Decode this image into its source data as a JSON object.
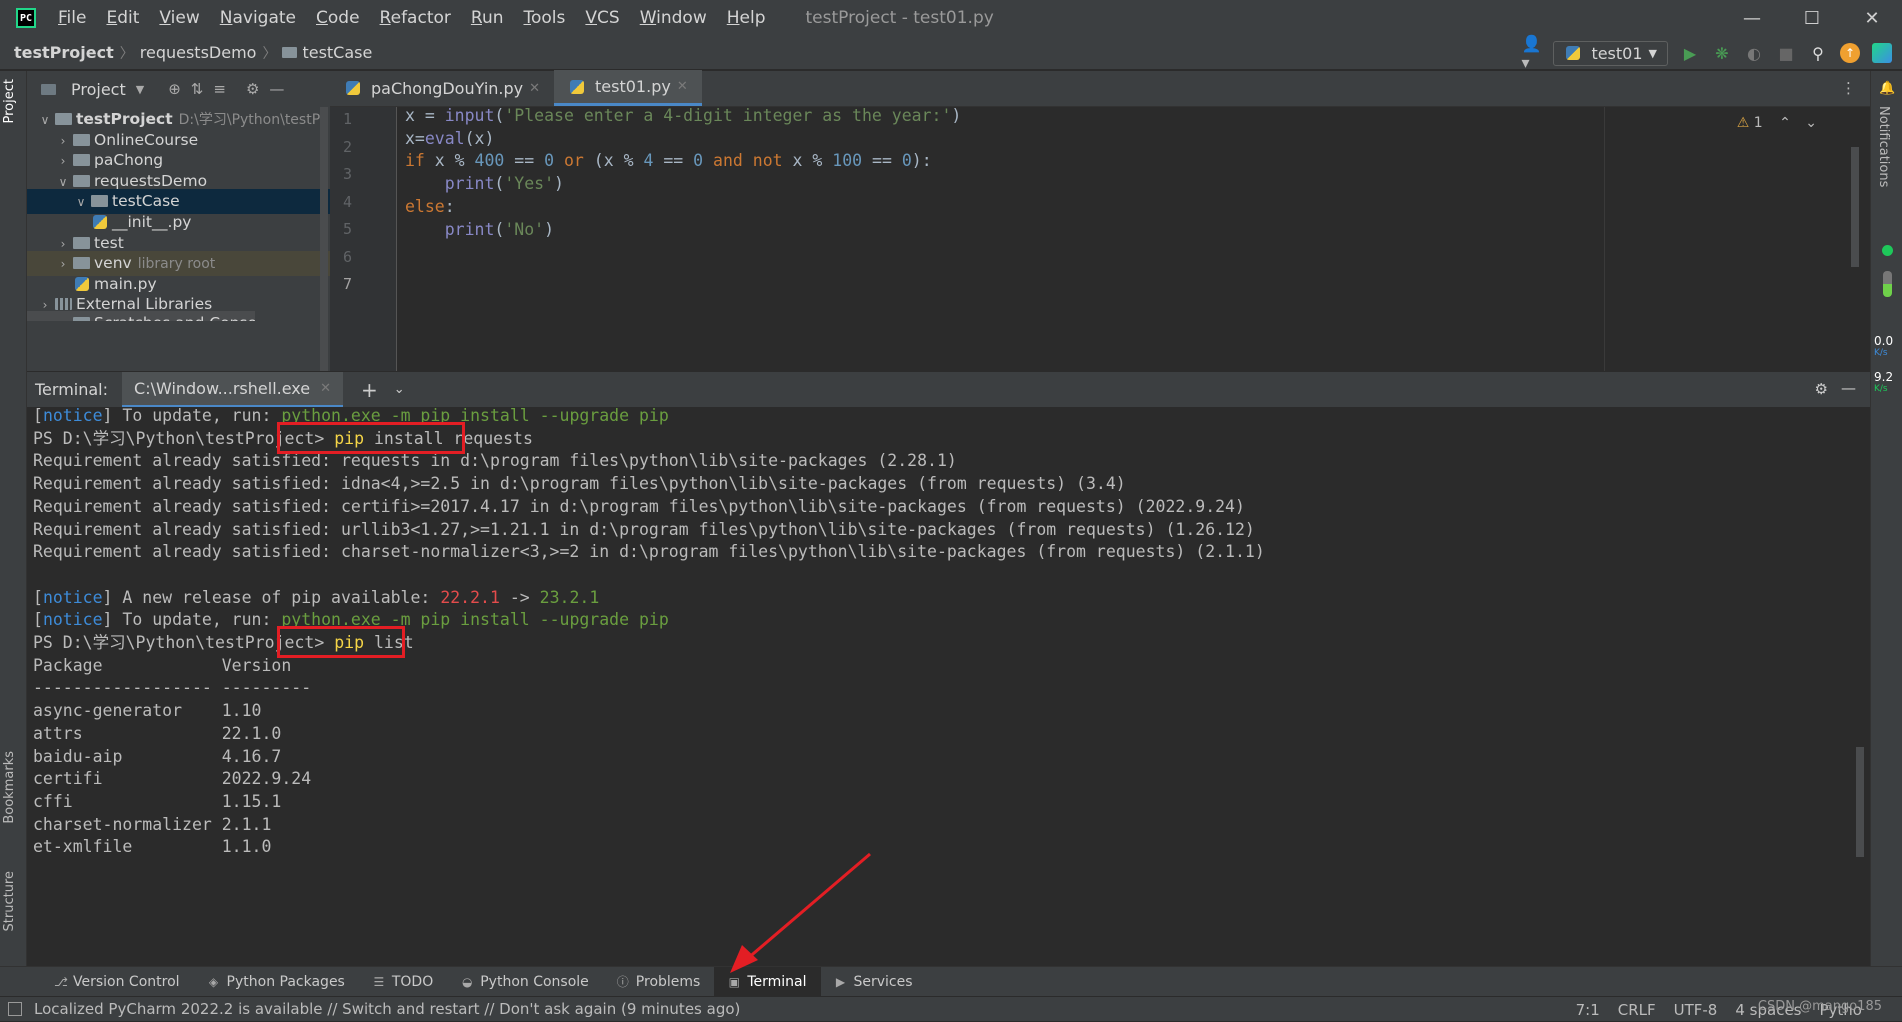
{
  "window": {
    "title": "testProject - test01.py",
    "menu": [
      {
        "u": "F",
        "rest": "ile"
      },
      {
        "u": "E",
        "rest": "dit"
      },
      {
        "u": "V",
        "rest": "iew"
      },
      {
        "u": "N",
        "rest": "avigate"
      },
      {
        "u": "C",
        "rest": "ode"
      },
      {
        "u": "R",
        "rest": "efactor"
      },
      {
        "u": "R",
        "rest": "un"
      },
      {
        "u": "T",
        "rest": "ools"
      },
      {
        "u": "V",
        "rest": "CS"
      },
      {
        "u": "W",
        "rest": "indow"
      },
      {
        "u": "H",
        "rest": "elp"
      }
    ]
  },
  "breadcrumb": [
    "testProject",
    "requestsDemo",
    "testCase"
  ],
  "run_config": "test01",
  "project_panel": {
    "title": "Project",
    "tree": [
      {
        "label": "testProject",
        "extra": "D:\\学习\\Python\\testPr",
        "depth": 0,
        "expanded": true,
        "bold": true
      },
      {
        "label": "OnlineCourse",
        "depth": 1
      },
      {
        "label": "paChong",
        "depth": 1
      },
      {
        "label": "requestsDemo",
        "depth": 1,
        "expanded": true
      },
      {
        "label": "testCase",
        "depth": 2,
        "expanded": true,
        "selected": true
      },
      {
        "label": "__init__.py",
        "depth": 3,
        "py": true
      },
      {
        "label": "test",
        "depth": 1
      },
      {
        "label": "venv",
        "extra": "library root",
        "depth": 1
      },
      {
        "label": "main.py",
        "depth": 2,
        "py": true
      },
      {
        "label": "External Libraries",
        "depth": 0
      },
      {
        "label": "Scratches and Consoles",
        "depth": 1
      }
    ]
  },
  "editor": {
    "tabs": [
      {
        "label": "paChongDouYin.py",
        "active": false
      },
      {
        "label": "test01.py",
        "active": true
      }
    ],
    "warning_count": "1",
    "line_numbers": [
      "1",
      "2",
      "3",
      "4",
      "5",
      "6",
      "7"
    ],
    "lines": [
      "x = input('Please enter a 4-digit integer as the year:')",
      "x=eval(x)",
      "if x % 400 == 0 or (x % 4 == 0 and not x % 100 == 0):",
      "    print('Yes')",
      "else:",
      "    print('No')",
      ""
    ]
  },
  "terminal": {
    "label": "Terminal:",
    "tab": "C:\\Window...rshell.exe",
    "lines": [
      {
        "t": "notice",
        "a": "[",
        "b": "notice",
        "c": "] To update, run: ",
        "d": "python.exe -m pip install --upgrade pip"
      },
      {
        "t": "cmd",
        "prompt": "PS D:\\学习\\Python\\testProject> ",
        "cmd": "pip install requests"
      },
      {
        "t": "plain",
        "text": "Requirement already satisfied: requests in d:\\program files\\python\\lib\\site-packages (2.28.1)"
      },
      {
        "t": "plain",
        "text": "Requirement already satisfied: idna<4,>=2.5 in d:\\program files\\python\\lib\\site-packages (from requests) (3.4)"
      },
      {
        "t": "plain",
        "text": "Requirement already satisfied: certifi>=2017.4.17 in d:\\program files\\python\\lib\\site-packages (from requests) (2022.9.24)"
      },
      {
        "t": "plain",
        "text": "Requirement already satisfied: urllib3<1.27,>=1.21.1 in d:\\program files\\python\\lib\\site-packages (from requests) (1.26.12)"
      },
      {
        "t": "plain",
        "text": "Requirement already satisfied: charset-normalizer<3,>=2 in d:\\program files\\python\\lib\\site-packages (from requests) (2.1.1)"
      },
      {
        "t": "plain",
        "text": ""
      },
      {
        "t": "release",
        "a": "[",
        "b": "notice",
        "c": "] A new release of pip available: ",
        "old": "22.2.1",
        "arrow": " -> ",
        "new": "23.2.1"
      },
      {
        "t": "notice",
        "a": "[",
        "b": "notice",
        "c": "] To update, run: ",
        "d": "python.exe -m pip install --upgrade pip"
      },
      {
        "t": "cmd",
        "prompt": "PS D:\\学习\\Python\\testProject> ",
        "cmd": "pip list"
      },
      {
        "t": "plain",
        "text": "Package            Version"
      },
      {
        "t": "plain",
        "text": "------------------ ---------"
      },
      {
        "t": "plain",
        "text": "async-generator    1.10"
      },
      {
        "t": "plain",
        "text": "attrs              22.1.0"
      },
      {
        "t": "plain",
        "text": "baidu-aip          4.16.7"
      },
      {
        "t": "plain",
        "text": "certifi            2022.9.24"
      },
      {
        "t": "plain",
        "text": "cffi               1.15.1"
      },
      {
        "t": "plain",
        "text": "charset-normalizer 2.1.1"
      },
      {
        "t": "plain",
        "text": "et-xmlfile         1.1.0"
      }
    ]
  },
  "left_strip": {
    "project": "Project",
    "bookmarks": "Bookmarks",
    "structure": "Structure"
  },
  "right_strip": {
    "notifications": "Notifications",
    "net_top": "0.0",
    "net_top_unit": "K/s",
    "net_bottom": "9.2",
    "net_bottom_unit": "K/s"
  },
  "tool_tabs": [
    {
      "label": "Version Control",
      "icon": "branch-icon",
      "active": false
    },
    {
      "label": "Python Packages",
      "icon": "packages-icon",
      "active": false
    },
    {
      "label": "TODO",
      "icon": "todo-icon",
      "active": false
    },
    {
      "label": "Python Console",
      "icon": "python-console-icon",
      "active": false
    },
    {
      "label": "Problems",
      "icon": "problems-icon",
      "active": false
    },
    {
      "label": "Terminal",
      "icon": "terminal-icon",
      "active": true
    },
    {
      "label": "Services",
      "icon": "services-icon",
      "active": false
    }
  ],
  "status_bar": {
    "message": "Localized PyCharm 2022.2 is available // Switch and restart // Don't ask again (9 minutes ago)",
    "position": "7:1",
    "line_sep": "CRLF",
    "encoding": "UTF-8",
    "indent": "4 spaces",
    "interpreter": "Pytho",
    "watermark": "CSDN @mango185"
  },
  "colors": {
    "accent": "#4a88c7",
    "highlight_box": "#e31e24",
    "arrow": "#e31e24"
  }
}
